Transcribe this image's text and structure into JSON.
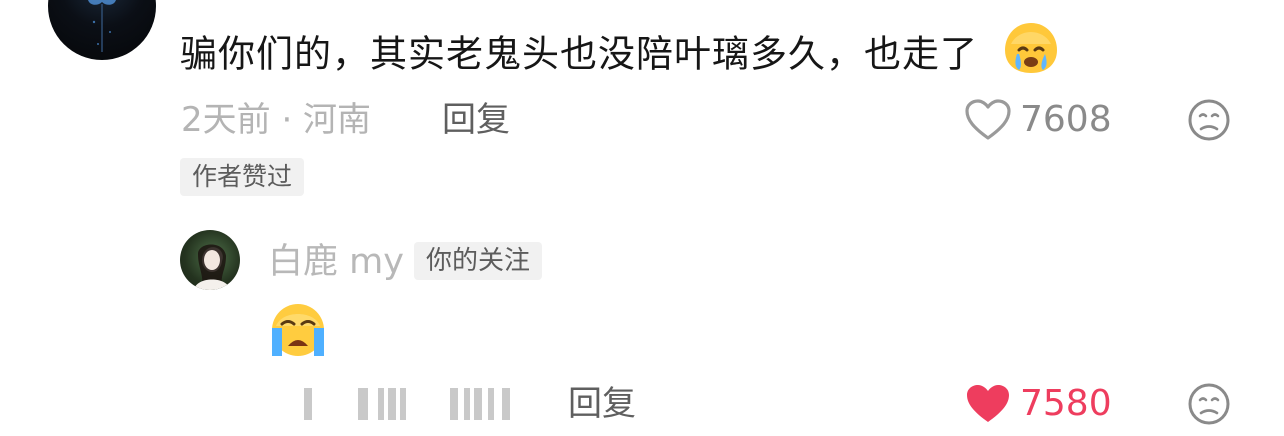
{
  "comment": {
    "text": "骗你们的，其实老鬼头也没陪叶璃多久，也走了",
    "time_location": "2天前 · 河南",
    "reply_label": "回复",
    "like_count": "7608",
    "liked": false,
    "author_badge": "作者赞过"
  },
  "reply": {
    "username": "白鹿 my",
    "follow_badge": "你的关注",
    "emoji": "crying-face",
    "reply_label": "回复",
    "like_count": "7580",
    "liked": true
  },
  "colors": {
    "liked_heart": "#ee3d5e",
    "meta_text": "#b4b4b4",
    "badge_bg": "#f1f1f1"
  }
}
